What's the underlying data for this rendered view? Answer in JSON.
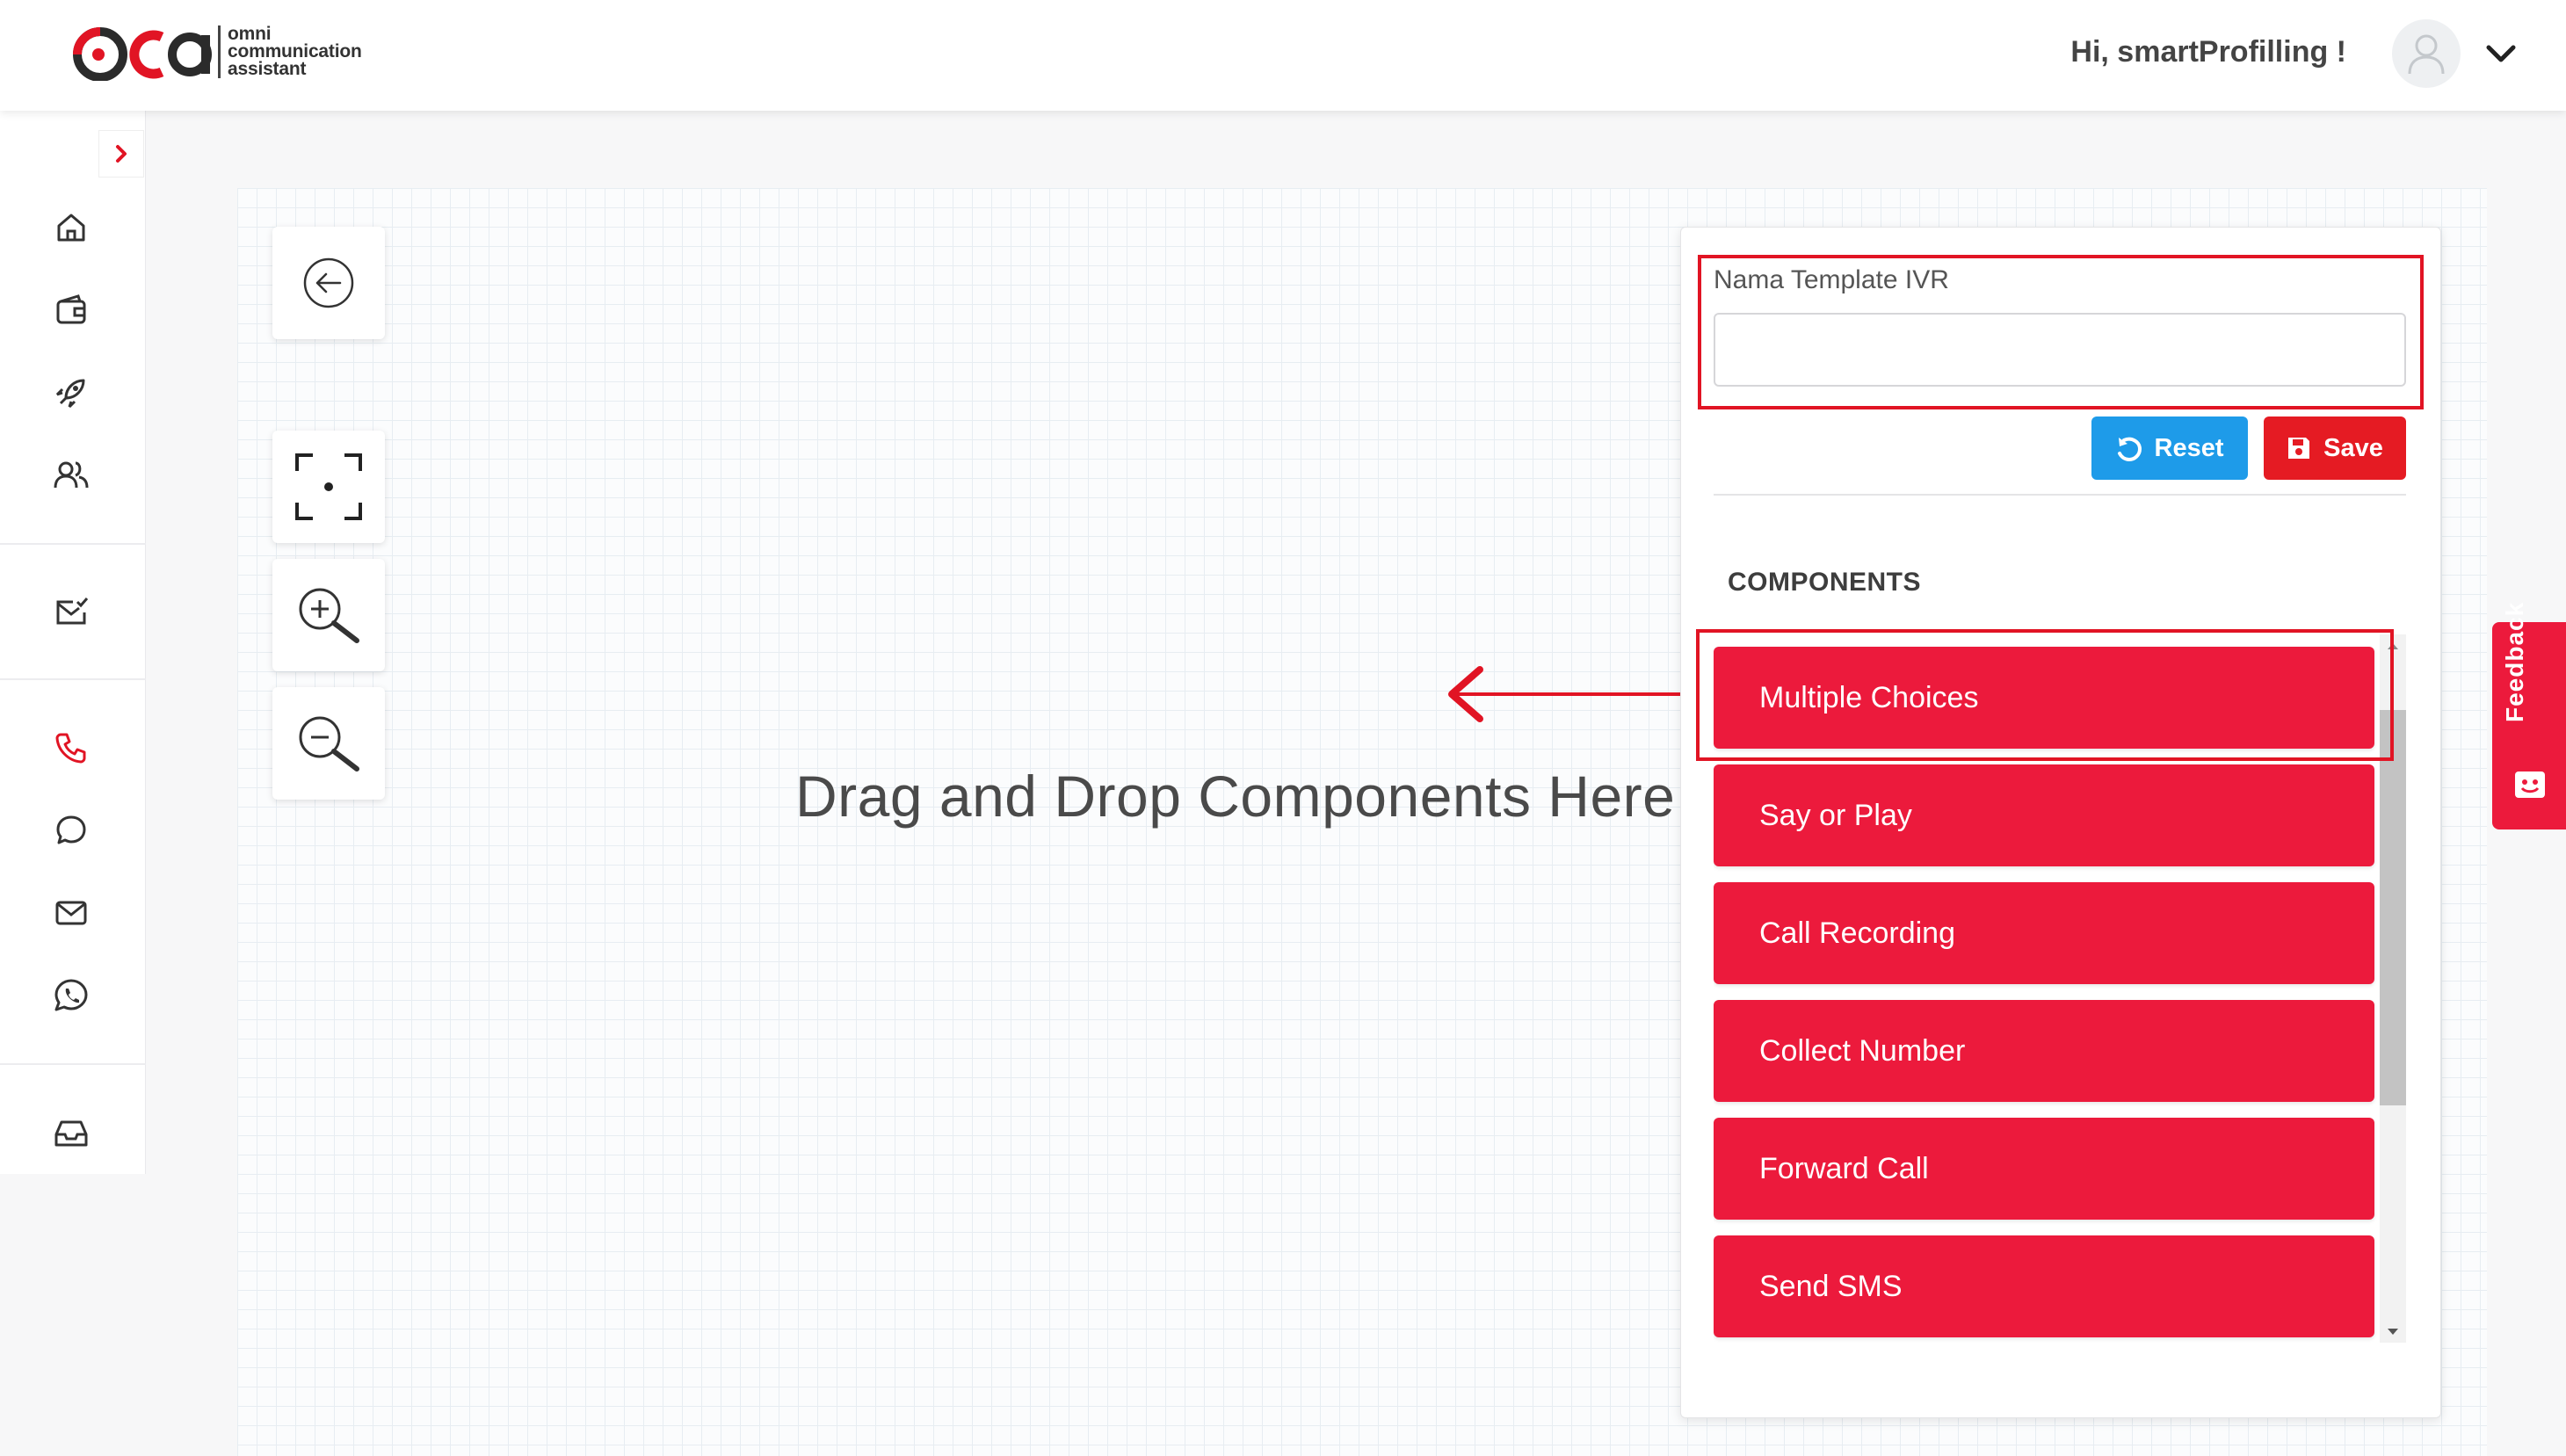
{
  "header": {
    "logo_text": [
      "omni",
      "communication",
      "assistant"
    ],
    "greeting": "Hi, smartProfilling !"
  },
  "canvas": {
    "drop_hint": "Drag and Drop Components Here"
  },
  "panel": {
    "template_label": "Nama Template IVR",
    "template_value": "",
    "reset_label": "Reset",
    "save_label": "Save",
    "components_title": "COMPONENTS",
    "components": [
      "Multiple Choices",
      "Say or Play",
      "Call Recording",
      "Collect Number",
      "Forward Call",
      "Send SMS"
    ]
  },
  "feedback": {
    "label": "Feedback"
  },
  "colors": {
    "brand_red": "#ec1a3c",
    "reset_blue": "#1e9be9",
    "save_red": "#e51b23",
    "highlight_red": "#e11424",
    "active_nav": "#e11424"
  }
}
